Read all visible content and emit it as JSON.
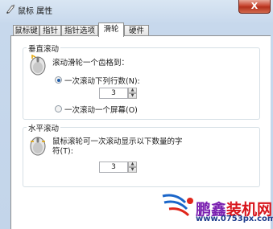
{
  "window": {
    "title": "鼠标 属性",
    "close_label": "X"
  },
  "tabs": [
    {
      "label": "鼠标键",
      "active": false
    },
    {
      "label": "指针",
      "active": false
    },
    {
      "label": "指针选项",
      "active": false
    },
    {
      "label": "滑轮",
      "active": true
    },
    {
      "label": "硬件",
      "active": false
    }
  ],
  "vertical": {
    "title": "垂直滚动",
    "prompt": "滚动滑轮一个齿格到：",
    "option_lines": "一次滚动下列行数(N):",
    "option_lines_selected": true,
    "lines_value": "3",
    "option_screen": "一次滚动一个屏幕(O)",
    "option_screen_selected": false
  },
  "horizontal": {
    "title": "水平滚动",
    "prompt_line1": "鼠标滚轮可一次滚动显示以下数量的字",
    "prompt_line2": "符(T):",
    "chars_value": "3"
  },
  "watermark": {
    "cn_part1": "鹏鑫",
    "cn_part2": "装机网",
    "url": "www.0753px.com"
  },
  "colors": {
    "accent": "#1e5ca8",
    "close": "#c74530",
    "logo_purple": "#7a1fb0",
    "logo_red": "#d8151c"
  }
}
